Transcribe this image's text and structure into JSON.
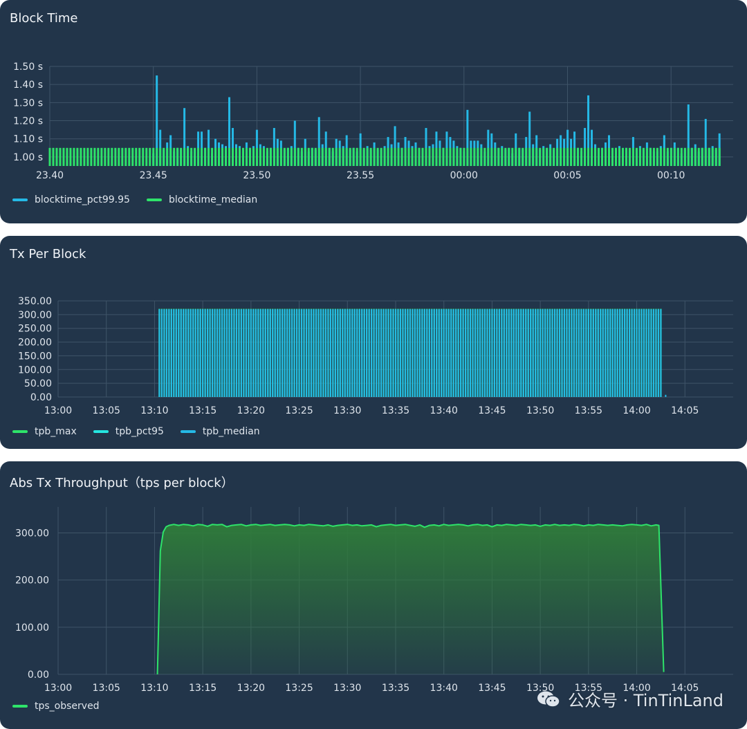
{
  "panels": [
    {
      "title": "Block Time"
    },
    {
      "title": "Tx Per Block"
    },
    {
      "title": "Abs Tx Throughput（tps per block）"
    }
  ],
  "watermark": {
    "text": "公众号 · TinTinLand",
    "icon": "wechat-logo-icon"
  },
  "colors": {
    "panel_bg": "#22354a",
    "grid": "#3f5468",
    "cyan": "#25b9e6",
    "green": "#2ee36a",
    "aqua": "#25e5e0",
    "area_green": "#2f7d3a"
  },
  "chart_data": [
    {
      "type": "bar",
      "title": "Block Time",
      "xlabel": "",
      "ylabel": "",
      "x_ticks": [
        "23.40",
        "23.45",
        "23.50",
        "23.55",
        "00:00",
        "00:05",
        "00:10"
      ],
      "y_ticks": [
        "1.00 s",
        "1.10 s",
        "1.20 s",
        "1.30 s",
        "1.40 s",
        "1.50 s"
      ],
      "ylim": [
        0.95,
        1.5
      ],
      "x_range_minutes": [
        -20,
        13
      ],
      "bar_start_minute": -20,
      "bar_interval_minutes": 0.1667,
      "series": [
        {
          "name": "blocktime_pct99.95",
          "color": "#25b9e6",
          "note_start_minute": -15,
          "values": [
            1.02,
            1.45,
            1.15,
            1.04,
            1.08,
            1.12,
            1.03,
            1.05,
            1.04,
            1.27,
            1.06,
            1.03,
            1.04,
            1.14,
            1.14,
            1.05,
            1.15,
            1.02,
            1.1,
            1.08,
            1.07,
            1.06,
            1.33,
            1.16,
            1.07,
            1.06,
            1.03,
            1.08,
            1.05,
            1.06,
            1.15,
            1.07,
            1.06,
            1.03,
            1.05,
            1.16,
            1.1,
            1.09,
            1.04,
            1.05,
            1.06,
            1.2,
            1.05,
            1.03,
            1.1,
            1.03,
            1.05,
            1.04,
            1.22,
            1.07,
            1.14,
            1.05,
            1.03,
            1.1,
            1.09,
            1.06,
            1.12,
            1.04,
            1.05,
            1.03,
            1.13,
            1.04,
            1.06,
            1.04,
            1.08,
            1.04,
            1.04,
            1.06,
            1.11,
            1.07,
            1.17,
            1.08,
            1.05,
            1.11,
            1.09,
            1.06,
            1.08,
            1.05,
            1.03,
            1.16,
            1.06,
            1.07,
            1.14,
            1.09,
            1.05,
            1.14,
            1.11,
            1.09,
            1.06,
            1.05,
            1.03,
            1.26,
            1.09,
            1.09,
            1.09,
            1.07,
            1.03,
            1.15,
            1.13,
            1.08,
            1.05,
            1.06,
            1.04,
            1.05,
            1.02,
            1.13,
            1.05,
            1.04,
            1.11,
            1.25,
            1.07,
            1.12,
            1.04,
            1.06,
            1.05,
            1.07,
            1.04,
            1.1,
            1.12,
            1.1,
            1.15,
            1.1,
            1.14,
            1.05,
            1.03,
            1.16,
            1.34,
            1.15,
            1.07,
            1.04,
            1.05,
            1.08,
            1.12,
            1.03,
            1.05,
            1.06,
            1.03,
            1.05,
            1.03,
            1.11,
            1.04,
            1.06,
            1.04,
            1.08,
            1.05,
            1.03,
            1.03,
            1.06,
            1.12,
            1.03,
            1.05,
            1.08,
            1.05,
            1.02,
            1.04,
            1.29,
            1.05,
            1.07,
            1.03,
            1.05,
            1.21,
            1.05,
            1.06,
            1.04,
            1.13,
            1.03,
            1.05,
            1.08,
            1.03,
            1.04,
            1.11,
            1.04,
            1.08,
            1.15,
            1.06,
            1.09,
            1.04,
            1.05,
            1.08,
            1.03,
            1.05,
            1.03,
            1.36,
            1.07,
            1.04,
            1.05,
            1.03,
            1.05,
            1.28,
            1.04,
            1.03,
            1.06,
            1.07,
            1.04,
            1.08,
            1.27,
            1.05,
            1.03,
            1.06,
            1.02,
            1.08,
            1.06,
            1.04,
            1.1,
            1.22,
            1.05,
            1.08,
            1.03,
            1.09,
            1.07,
            1.11,
            1.09,
            1.06,
            1.05,
            1.08,
            1.06,
            1.04,
            1.12,
            1.05,
            1.07,
            1.03,
            1.06,
            1.05,
            1.11,
            1.04,
            1.08,
            1.05,
            1.13,
            1.07,
            1.04,
            1.14,
            1.06,
            1.03,
            1.08,
            1.15,
            1.05,
            1.16,
            1.03,
            1.07,
            1.11,
            1.05,
            1.22,
            1.03,
            1.08,
            1.06,
            1.04,
            1.05,
            1.21,
            1.26,
            1.06,
            1.05,
            1.07,
            1.3,
            1.04,
            1.09,
            1.05,
            1.23,
            1.06,
            1.04,
            1.05,
            1.22,
            1.07,
            1.03,
            1.05,
            1.08,
            1.11,
            1.06,
            1.12,
            1.09,
            1.05,
            1.22,
            1.04,
            1.06,
            1.04,
            1.08,
            1.06,
            1.03,
            1.03,
            1.06,
            1.11,
            1.08,
            1.05,
            1.03,
            1.06,
            1.07,
            1.02,
            1.11,
            1.09,
            1.04,
            1.03,
            1.03,
            1.03,
            1.06,
            1.02,
            1.25,
            1.05,
            1.04,
            1.03,
            1.07,
            1.03,
            1.03,
            1.05,
            1.05,
            1.02,
            1.03,
            1.04,
            1.03,
            1.02,
            1.04,
            1.02,
            1.03,
            1.02,
            1.04,
            1.02,
            1.02,
            1.03,
            1.02,
            1.03,
            1.03,
            1.02,
            1.12,
            1.02,
            1.03,
            1.02
          ]
        },
        {
          "name": "blocktime_median",
          "color": "#2ee36a",
          "constant": 1.01
        }
      ],
      "legend": [
        "blocktime_pct99.95",
        "blocktime_median"
      ],
      "legend_position": "bottom-left",
      "grid": true
    },
    {
      "type": "bar",
      "title": "Tx Per Block",
      "xlabel": "",
      "ylabel": "",
      "x_ticks": [
        "13:00",
        "13:05",
        "13:10",
        "13:15",
        "13:20",
        "13:25",
        "13:30",
        "13:35",
        "13:40",
        "13:45",
        "13:50",
        "13:55",
        "14:00",
        "14:05"
      ],
      "y_ticks": [
        "0.00",
        "50.00",
        "100.00",
        "150.00",
        "200.00",
        "250.00",
        "300.00",
        "350.00"
      ],
      "ylim": [
        0,
        350
      ],
      "x_range_minutes": [
        0,
        70
      ],
      "data_start_minute": 10.5,
      "data_end_minute": 62.7,
      "bar_interval_minutes": 0.25,
      "series": [
        {
          "name": "tpb_max",
          "color": "#2ee36a",
          "value": 320
        },
        {
          "name": "tpb_pct95",
          "color": "#25e5e0",
          "value": 320
        },
        {
          "name": "tpb_median",
          "color": "#25b9e6",
          "value": 320
        }
      ],
      "tail": {
        "minute": 63.0,
        "value": 8
      },
      "legend": [
        "tpb_max",
        "tpb_pct95",
        "tpb_median"
      ],
      "legend_position": "bottom-left",
      "grid": true
    },
    {
      "type": "area",
      "title": "Abs Tx Throughput（tps per block）",
      "xlabel": "",
      "ylabel": "",
      "x_ticks": [
        "13:00",
        "13:05",
        "13:10",
        "13:15",
        "13:20",
        "13:25",
        "13:30",
        "13:35",
        "13:40",
        "13:45",
        "13:50",
        "13:55",
        "14:00",
        "14:05"
      ],
      "y_ticks": [
        "0.00",
        "100.00",
        "200.00",
        "300.00"
      ],
      "ylim": [
        0,
        355
      ],
      "x_range_minutes": [
        0,
        70
      ],
      "series": [
        {
          "name": "tps_observed",
          "color": "#2ee36a",
          "points": [
            [
              10.3,
              0
            ],
            [
              10.6,
              262
            ],
            [
              10.9,
              302
            ],
            [
              11.2,
              313
            ],
            [
              11.5,
              316
            ],
            [
              12,
              318
            ],
            [
              12.5,
              316
            ],
            [
              13,
              318
            ],
            [
              13.5,
              317
            ],
            [
              14,
              315
            ],
            [
              14.5,
              318
            ],
            [
              15,
              317
            ],
            [
              15.5,
              314
            ],
            [
              16,
              318
            ],
            [
              16.5,
              317
            ],
            [
              17,
              318
            ],
            [
              17.5,
              313
            ],
            [
              18,
              316
            ],
            [
              18.5,
              317
            ],
            [
              19,
              318
            ],
            [
              19.5,
              315
            ],
            [
              20,
              317
            ],
            [
              20.5,
              318
            ],
            [
              21,
              316
            ],
            [
              21.5,
              317
            ],
            [
              22,
              318
            ],
            [
              22.5,
              316
            ],
            [
              23,
              317
            ],
            [
              23.5,
              318
            ],
            [
              24,
              317
            ],
            [
              24.5,
              315
            ],
            [
              25,
              317
            ],
            [
              25.5,
              316
            ],
            [
              26,
              318
            ],
            [
              26.5,
              317
            ],
            [
              27,
              316
            ],
            [
              27.5,
              315
            ],
            [
              28,
              317
            ],
            [
              28.5,
              314
            ],
            [
              29,
              316
            ],
            [
              29.5,
              317
            ],
            [
              30,
              318
            ],
            [
              30.5,
              316
            ],
            [
              31,
              317
            ],
            [
              31.5,
              315
            ],
            [
              32,
              316
            ],
            [
              32.5,
              317
            ],
            [
              33,
              313
            ],
            [
              33.5,
              316
            ],
            [
              34,
              317
            ],
            [
              34.5,
              318
            ],
            [
              35,
              316
            ],
            [
              35.5,
              317
            ],
            [
              36,
              318
            ],
            [
              36.5,
              316
            ],
            [
              37,
              314
            ],
            [
              37.5,
              317
            ],
            [
              38,
              312
            ],
            [
              38.5,
              316
            ],
            [
              39,
              317
            ],
            [
              39.5,
              315
            ],
            [
              40,
              318
            ],
            [
              40.5,
              316
            ],
            [
              41,
              317
            ],
            [
              41.5,
              318
            ],
            [
              42,
              317
            ],
            [
              42.5,
              315
            ],
            [
              43,
              317
            ],
            [
              43.5,
              318
            ],
            [
              44,
              316
            ],
            [
              44.5,
              317
            ],
            [
              45,
              313
            ],
            [
              45.5,
              317
            ],
            [
              46,
              316
            ],
            [
              46.5,
              318
            ],
            [
              47,
              317
            ],
            [
              47.5,
              316
            ],
            [
              48,
              318
            ],
            [
              48.5,
              317
            ],
            [
              49,
              316
            ],
            [
              49.5,
              317
            ],
            [
              50,
              314
            ],
            [
              50.5,
              317
            ],
            [
              51,
              316
            ],
            [
              51.5,
              318
            ],
            [
              52,
              316
            ],
            [
              52.5,
              317
            ],
            [
              53,
              316
            ],
            [
              53.5,
              318
            ],
            [
              54,
              317
            ],
            [
              54.5,
              315
            ],
            [
              55,
              317
            ],
            [
              55.5,
              316
            ],
            [
              56,
              318
            ],
            [
              56.5,
              317
            ],
            [
              57,
              316
            ],
            [
              57.5,
              317
            ],
            [
              58,
              316
            ],
            [
              58.5,
              315
            ],
            [
              59,
              317
            ],
            [
              59.5,
              318
            ],
            [
              60,
              317
            ],
            [
              60.5,
              316
            ],
            [
              61,
              318
            ],
            [
              61.5,
              315
            ],
            [
              62,
              317
            ],
            [
              62.3,
              316
            ],
            [
              62.8,
              5
            ]
          ]
        }
      ],
      "legend": [
        "tps_observed"
      ],
      "legend_position": "bottom-left",
      "grid": true
    }
  ]
}
